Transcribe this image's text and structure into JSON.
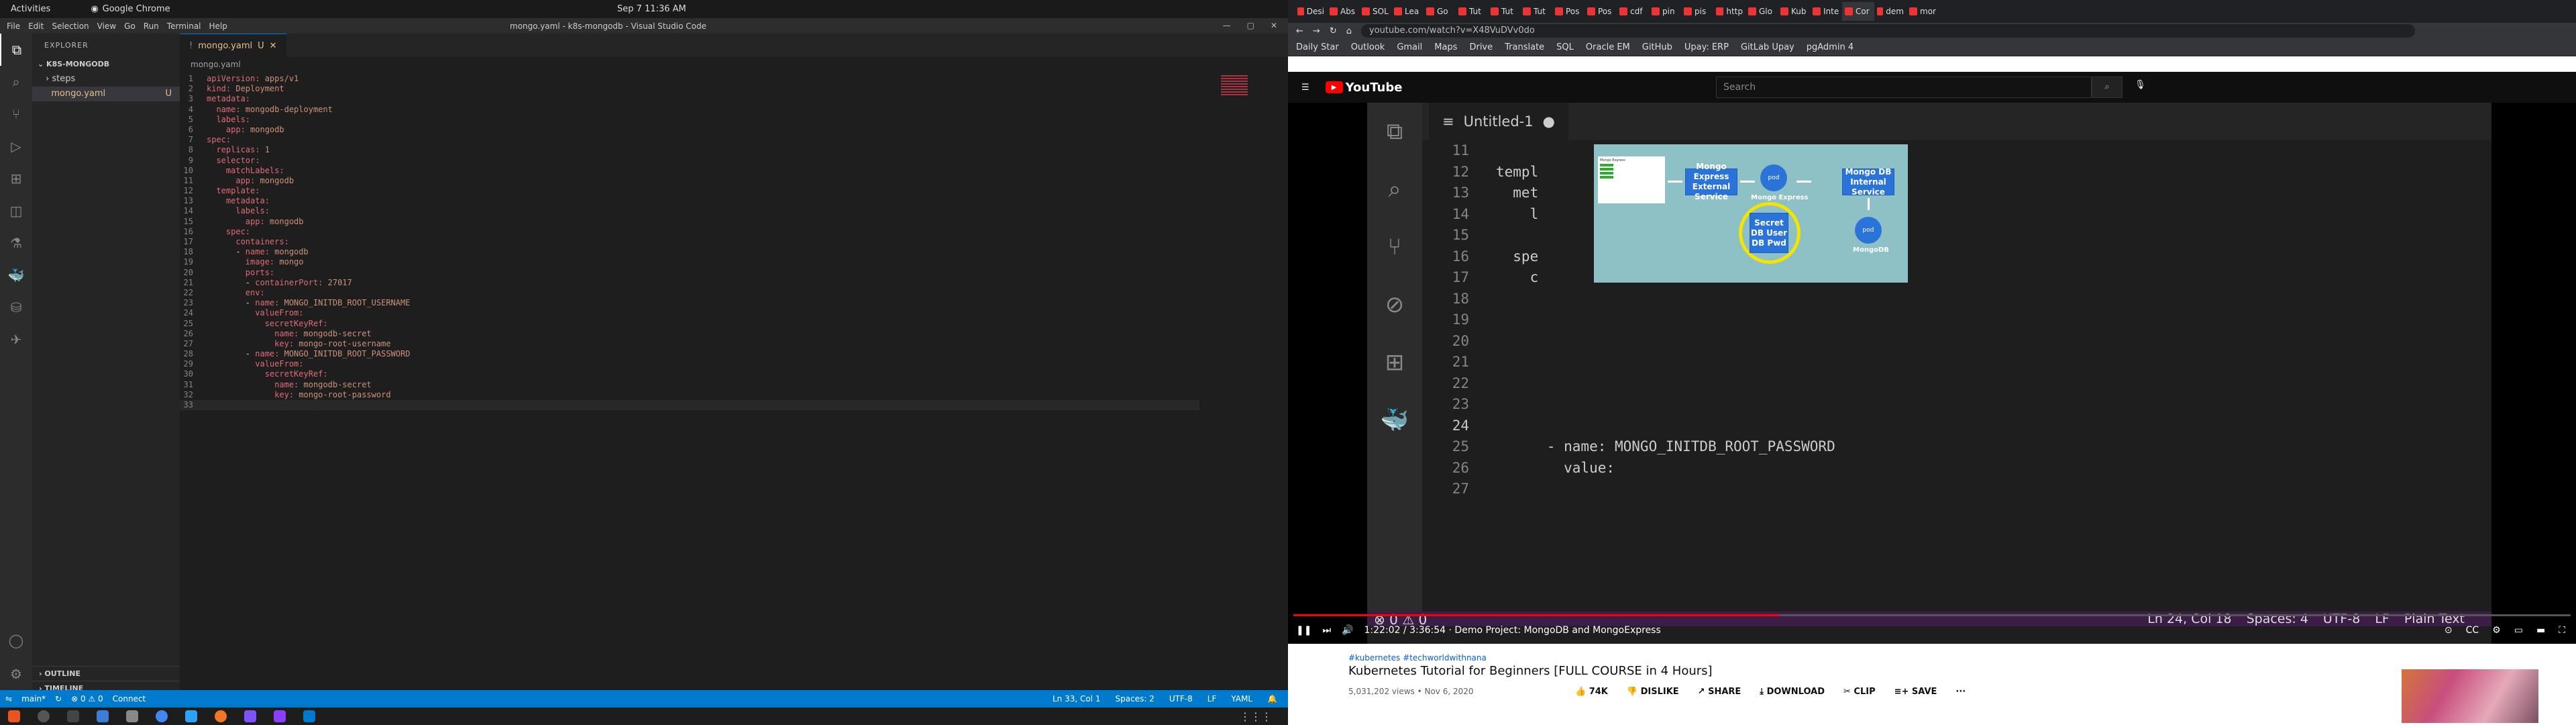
{
  "topbar": {
    "activities": "Activities",
    "app": "Google Chrome",
    "clock": "Sep 7  11:36 AM"
  },
  "vscode": {
    "title": "mongo.yaml - k8s-mongodb - Visual Studio Code",
    "menu": [
      "File",
      "Edit",
      "Selection",
      "View",
      "Go",
      "Run",
      "Terminal",
      "Help"
    ],
    "explorer": {
      "header": "EXPLORER",
      "project": "K8S-MONGODB",
      "items": [
        {
          "label": "steps"
        },
        {
          "label": "mongo.yaml",
          "badge": "U"
        }
      ],
      "outline": "OUTLINE",
      "timeline": "TIMELINE"
    },
    "tab": {
      "label": "mongo.yaml",
      "badge": "U"
    },
    "breadcrumb": "mongo.yaml",
    "code": [
      "apiVersion: apps/v1",
      "kind: Deployment",
      "metadata:",
      "  name: mongodb-deployment",
      "  labels:",
      "    app: mongodb",
      "spec:",
      "  replicas: 1",
      "  selector:",
      "    matchLabels:",
      "      app: mongodb",
      "  template:",
      "    metadata:",
      "      labels:",
      "        app: mongodb",
      "    spec:",
      "      containers:",
      "      - name: mongodb",
      "        image: mongo",
      "        ports:",
      "        - containerPort: 27017",
      "        env:",
      "        - name: MONGO_INITDB_ROOT_USERNAME",
      "          valueFrom:",
      "            secretKeyRef:",
      "              name: mongodb-secret",
      "              key: mongo-root-username",
      "        - name: MONGO_INITDB_ROOT_PASSWORD",
      "          valueFrom:",
      "            secretKeyRef:",
      "              name: mongodb-secret",
      "              key: mongo-root-password",
      ""
    ],
    "status": {
      "branch": "main*",
      "sync": "↻",
      "problems": "⊗ 0 ⚠ 0",
      "connect": "Connect",
      "position": "Ln 33, Col 1",
      "spaces": "Spaces: 2",
      "encoding": "UTF-8",
      "eol": "LF",
      "lang": "YAML"
    }
  },
  "chrome": {
    "tabs": [
      "Desi",
      "Abs",
      "SOL",
      "Lea",
      "Go",
      "Tut",
      "Tut",
      "Tut",
      "Pos",
      "Pos",
      "cdf",
      "pin",
      "pis",
      "http",
      "Glo",
      "Kub",
      "Inte",
      "Cor",
      "dem",
      "mor"
    ],
    "url": "youtube.com/watch?v=X48VuDVv0do",
    "bookmarks": [
      "Daily Star",
      "Outlook",
      "Gmail",
      "Maps",
      "Drive",
      "Translate",
      "SQL",
      "Oracle EM",
      "GitHub",
      "Upay: ERP",
      "GitLab Upay",
      "pgAdmin 4"
    ]
  },
  "youtube": {
    "search_placeholder": "Search",
    "video_editor": {
      "tab": "Untitled-1",
      "lines": [
        {
          "n": "11",
          "t": ""
        },
        {
          "n": "12",
          "t": "templ"
        },
        {
          "n": "13",
          "t": "  met"
        },
        {
          "n": "14",
          "t": "    l"
        },
        {
          "n": "15",
          "t": ""
        },
        {
          "n": "16",
          "t": "  spe"
        },
        {
          "n": "17",
          "t": "    c"
        },
        {
          "n": "18",
          "t": ""
        },
        {
          "n": "19",
          "t": ""
        },
        {
          "n": "20",
          "t": ""
        },
        {
          "n": "21",
          "t": ""
        },
        {
          "n": "22",
          "t": ""
        },
        {
          "n": "23",
          "t": ""
        },
        {
          "n": "24",
          "t": ""
        },
        {
          "n": "25",
          "t": "      - name: MONGO_INITDB_ROOT_PASSWORD"
        },
        {
          "n": "26",
          "t": "        value:"
        },
        {
          "n": "27",
          "t": ""
        }
      ],
      "status": {
        "errors": "⊗ 0 ⚠ 0",
        "position": "Ln 24, Col 18",
        "spaces": "Spaces: 4",
        "encoding": "UTF-8",
        "eol": "LF",
        "lang": "Plain Text"
      }
    },
    "slide": {
      "mini_title": "Mongo Express",
      "ext_service": "Mongo Express External Service",
      "pod": "pod",
      "me_label": "Mongo Express",
      "int_service": "Mongo DB Internal Service",
      "secret": [
        "Secret",
        "DB User",
        "DB Pwd"
      ],
      "mongodb_label": "MongoDB"
    },
    "time": "1:22:02 / 3:36:54 · Demo Project: MongoDB and MongoExpress",
    "progress": 0.38,
    "tags": "#kubernetes #techworldwithnana",
    "title": "Kubernetes Tutorial for Beginners [FULL COURSE in 4 Hours]",
    "views": "5,031,202 views • Nov 6, 2020",
    "actions": [
      "👍 74K",
      "👎 DISLIKE",
      "↗ SHARE",
      "⤓ DOWNLOAD",
      "✂ CLIP",
      "≡+ SAVE",
      "···"
    ]
  }
}
